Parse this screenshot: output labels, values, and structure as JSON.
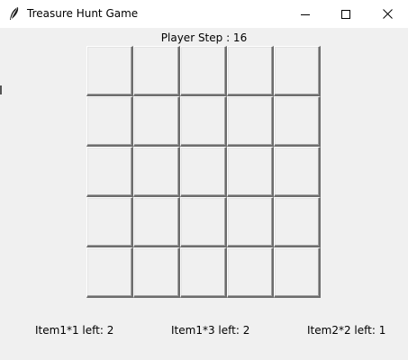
{
  "window": {
    "title": "Treasure Hunt Game",
    "icon": "feather-icon",
    "controls": [
      "minimize-icon",
      "maximize-icon",
      "close-icon"
    ]
  },
  "game": {
    "step_label": "Player Step : 16",
    "grid": {
      "rows": 5,
      "cols": 5
    }
  },
  "items": [
    {
      "label": "Item1*1 left: 2"
    },
    {
      "label": "Item1*3 left: 2"
    },
    {
      "label": "Item2*2 left: 1"
    }
  ]
}
